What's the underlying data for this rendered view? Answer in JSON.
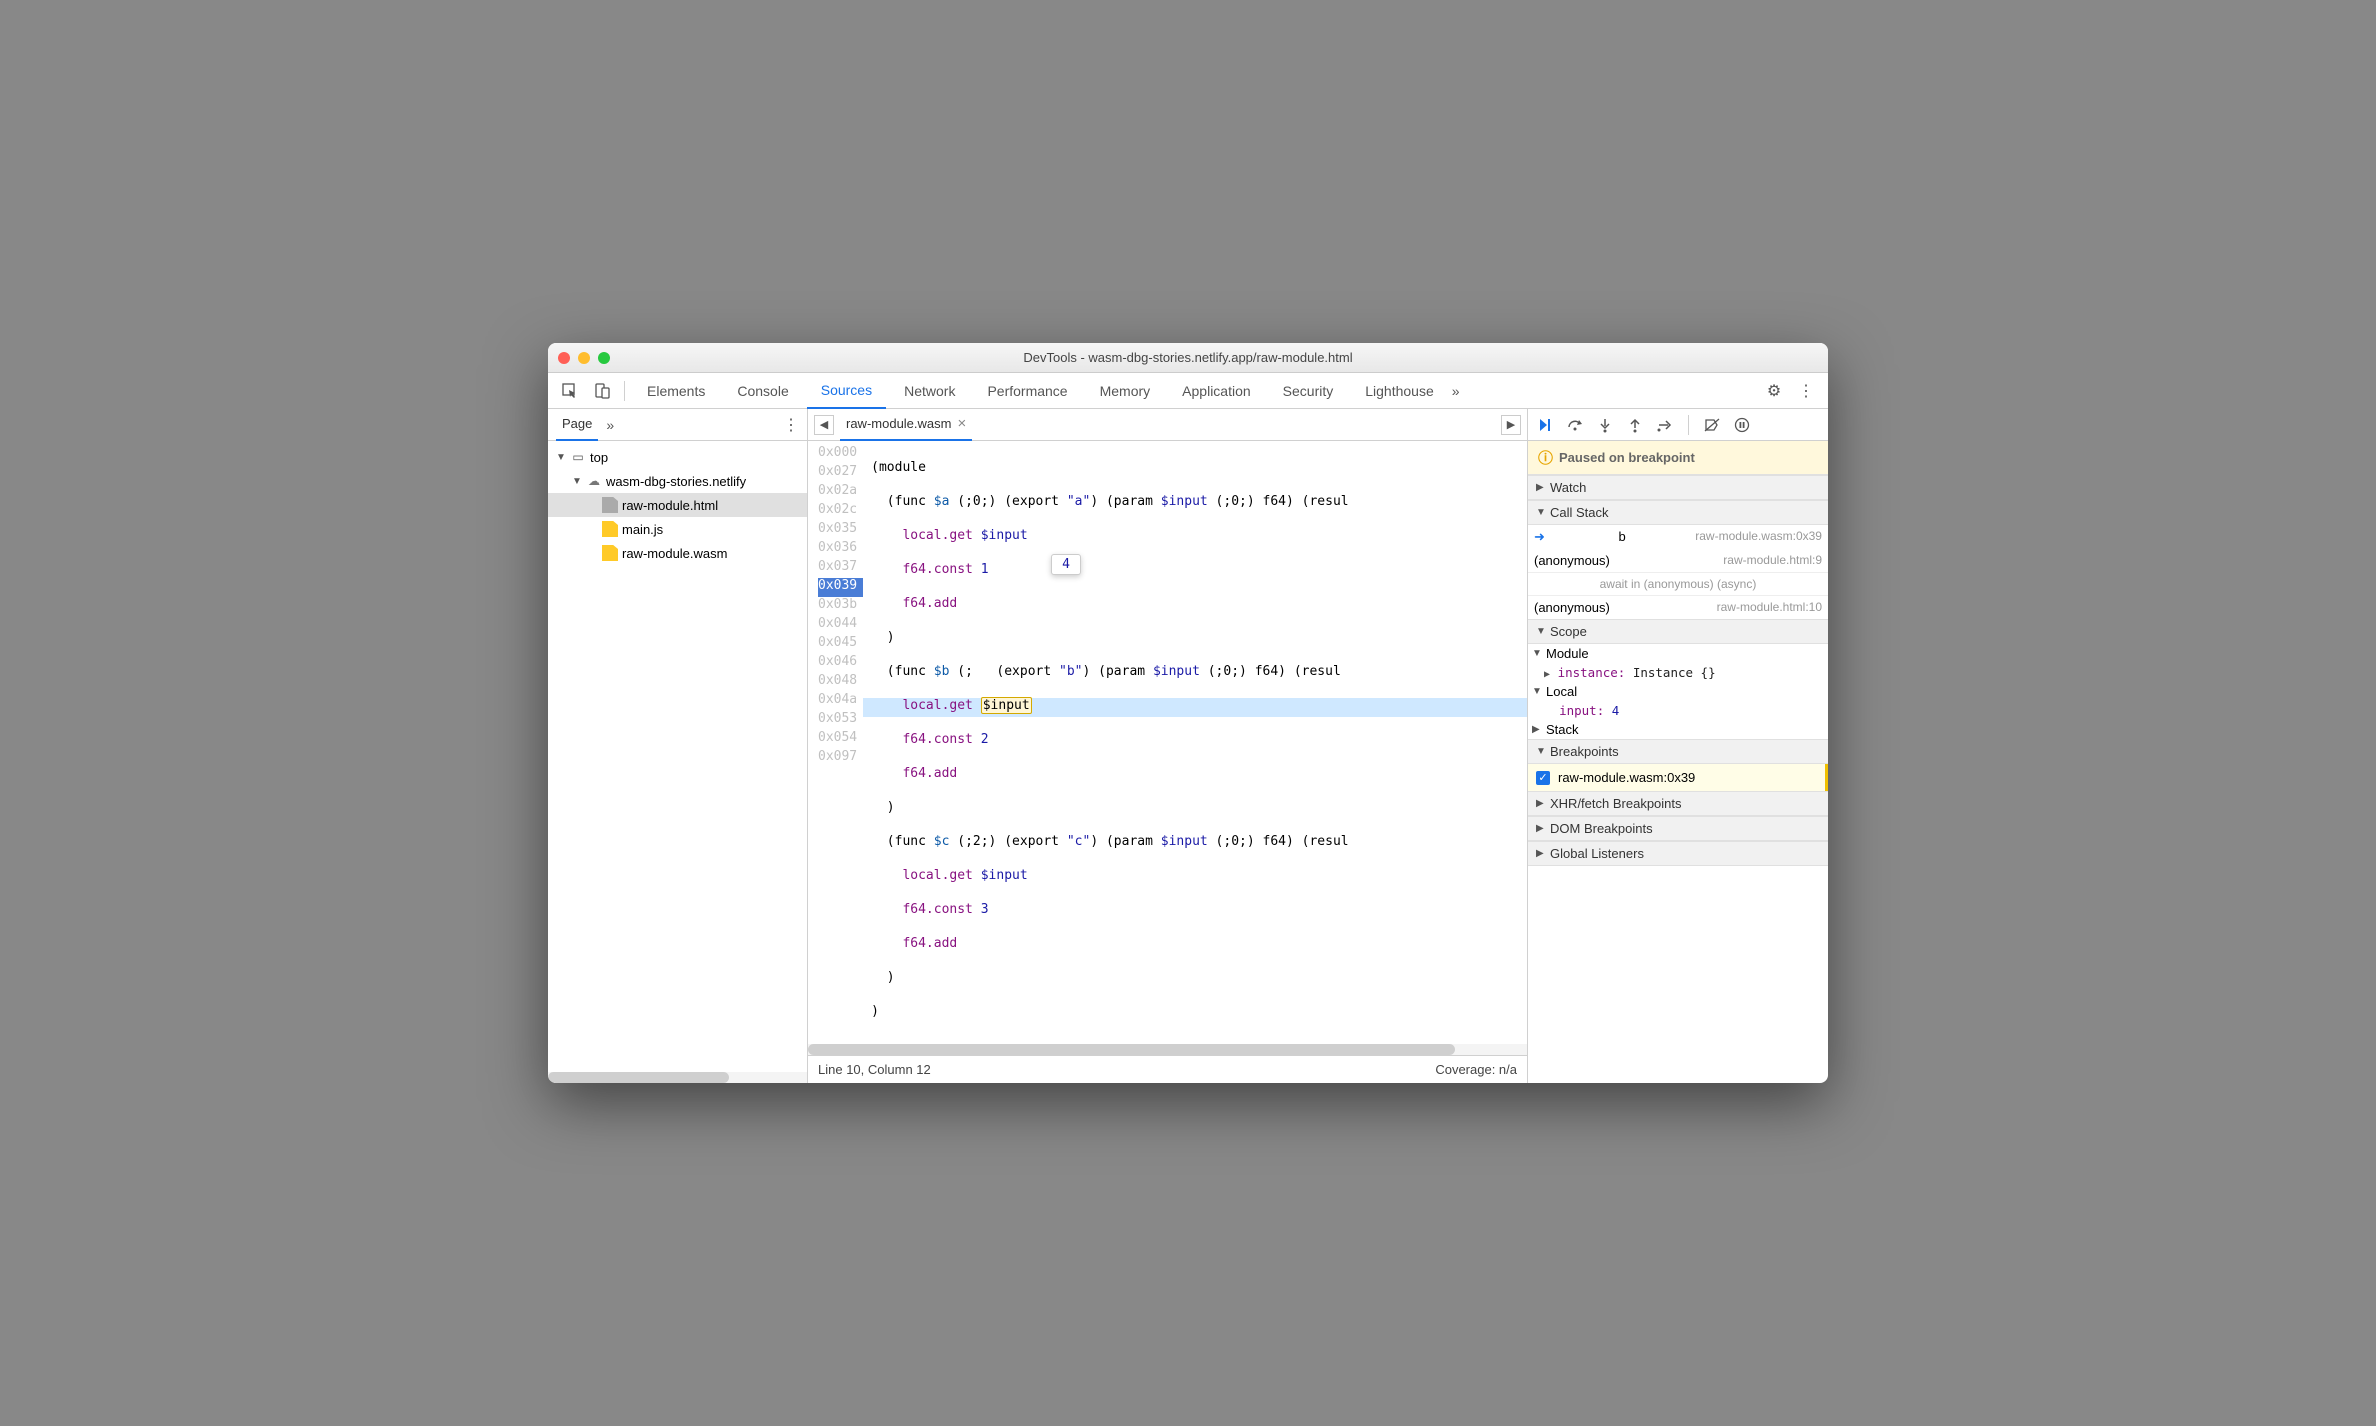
{
  "window_title": "DevTools - wasm-dbg-stories.netlify.app/raw-module.html",
  "toolbar_tabs": [
    "Elements",
    "Console",
    "Sources",
    "Network",
    "Performance",
    "Memory",
    "Application",
    "Security",
    "Lighthouse"
  ],
  "toolbar_active": "Sources",
  "side_nav_tab": "Page",
  "tree": {
    "top": "top",
    "origin": "wasm-dbg-stories.netlify",
    "files": [
      "raw-module.html",
      "main.js",
      "raw-module.wasm"
    ]
  },
  "open_file": "raw-module.wasm",
  "tooltip_value": "4",
  "gutter": [
    "0x000",
    "0x027",
    "0x02a",
    "0x02c",
    "0x035",
    "0x036",
    "0x037",
    "0x039",
    "0x03b",
    "0x044",
    "0x045",
    "0x046",
    "0x048",
    "0x04a",
    "0x053",
    "0x054",
    "0x097"
  ],
  "highlighted_gutter_index": 7,
  "status_left": "Line 10, Column 12",
  "status_right": "Coverage: n/a",
  "paused_msg": "Paused on breakpoint",
  "sections": {
    "watch": "Watch",
    "callstack": "Call Stack",
    "scope": "Scope",
    "bp": "Breakpoints",
    "xhr": "XHR/fetch Breakpoints",
    "dom": "DOM Breakpoints",
    "gl": "Global Listeners"
  },
  "callstack": [
    {
      "name": "b",
      "loc": "raw-module.wasm:0x39",
      "current": true
    },
    {
      "name": "(anonymous)",
      "loc": "raw-module.html:9"
    },
    {
      "async": "await in (anonymous) (async)"
    },
    {
      "name": "(anonymous)",
      "loc": "raw-module.html:10"
    }
  ],
  "scope": {
    "module_label": "Module",
    "instance_label": "instance:",
    "instance_val": "Instance {}",
    "local_label": "Local",
    "input_label": "input:",
    "input_val": "4",
    "stack_label": "Stack"
  },
  "breakpoint_entry": "raw-module.wasm:0x39",
  "code": {
    "l1": "(module",
    "l2_a": "  (func ",
    "l2_fn": "$a",
    "l2_b": " (;0;) (export ",
    "l2_s": "\"a\"",
    "l2_c": ") (param ",
    "l2_p": "$input",
    "l2_d": " (;0;) f64) (resul",
    "l3_a": "    local.get ",
    "l3_v": "$input",
    "l4_a": "    f64.const ",
    "l4_n": "1",
    "l5": "    f64.add",
    "l6": "  )",
    "l7_a": "  (func ",
    "l7_fn": "$b",
    "l7_b": " (;   (export ",
    "l7_s": "\"b\"",
    "l7_c": ") (param ",
    "l7_p": "$input",
    "l7_d": " (;0;) f64) (resul",
    "l8_a": "    local.get ",
    "l8_v": "$input",
    "l9_a": "    f64.const ",
    "l9_n": "2",
    "l10": "    f64.add",
    "l11": "  )",
    "l12_a": "  (func ",
    "l12_fn": "$c",
    "l12_b": " (;2;) (export ",
    "l12_s": "\"c\"",
    "l12_c": ") (param ",
    "l12_p": "$input",
    "l12_d": " (;0;) f64) (resul",
    "l13_a": "    local.get ",
    "l13_v": "$input",
    "l14_a": "    f64.const ",
    "l14_n": "3",
    "l15": "    f64.add",
    "l16": "  )",
    "l17": ")"
  }
}
